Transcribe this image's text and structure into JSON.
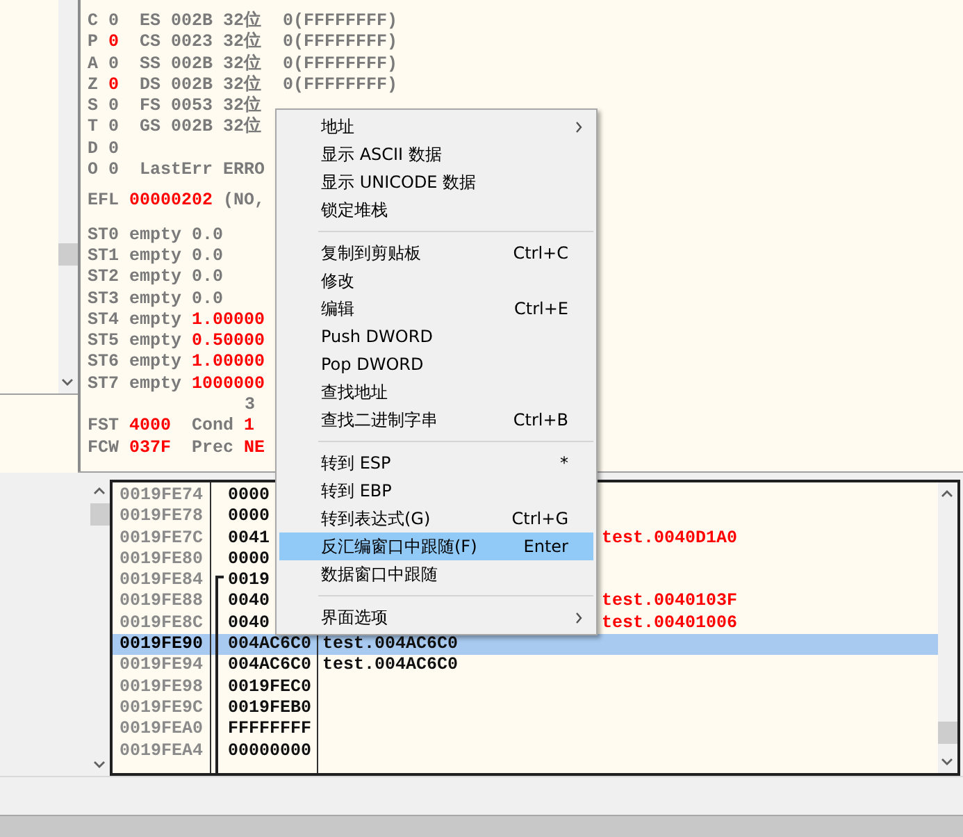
{
  "registers": {
    "groups": [
      [
        {
          "kind": "row",
          "segments": [
            {
              "text": "C",
              "changed": false
            },
            {
              "text": "0",
              "changed": false
            },
            {
              "text": " ES 002B 32位  0(FFFFFFFF)",
              "changed": false
            }
          ]
        },
        {
          "kind": "row",
          "segments": [
            {
              "text": "P",
              "changed": false
            },
            {
              "text": "0",
              "changed": true
            },
            {
              "text": " CS 0023 32位  0(FFFFFFFF)",
              "changed": false
            }
          ]
        },
        {
          "kind": "row",
          "segments": [
            {
              "text": "A",
              "changed": false
            },
            {
              "text": "0",
              "changed": false
            },
            {
              "text": " SS 002B 32位  0(FFFFFFFF)",
              "changed": false
            }
          ]
        },
        {
          "kind": "row",
          "segments": [
            {
              "text": "Z",
              "changed": false
            },
            {
              "text": "0",
              "changed": true
            },
            {
              "text": " DS 002B 32位  0(FFFFFFFF)",
              "changed": false
            }
          ]
        },
        {
          "kind": "row",
          "segments": [
            {
              "text": "S",
              "changed": false
            },
            {
              "text": "0",
              "changed": false
            },
            {
              "text": " FS 0053 32位",
              "changed": false
            }
          ]
        },
        {
          "kind": "row",
          "segments": [
            {
              "text": "T",
              "changed": false
            },
            {
              "text": "0",
              "changed": false
            },
            {
              "text": " GS 002B 32位",
              "changed": false
            }
          ]
        },
        {
          "kind": "row",
          "segments": [
            {
              "text": "D",
              "changed": false
            },
            {
              "text": "0",
              "changed": false
            }
          ]
        },
        {
          "kind": "row",
          "segments": [
            {
              "text": "O",
              "changed": false
            },
            {
              "text": "0",
              "changed": false
            },
            {
              "text": " LastErr ERRO",
              "changed": false
            }
          ]
        }
      ],
      [
        {
          "kind": "row",
          "segments": [
            {
              "text": "EFL",
              "changed": false
            },
            {
              "text": "00000202",
              "changed": true
            },
            {
              "text": "(NO,",
              "changed": false
            }
          ]
        }
      ],
      [
        {
          "kind": "row",
          "segments": [
            {
              "text": "ST0",
              "changed": false
            },
            {
              "text": "empty",
              "changed": false
            },
            {
              "text": "0.0",
              "changed": false
            }
          ]
        },
        {
          "kind": "row",
          "segments": [
            {
              "text": "ST1",
              "changed": false
            },
            {
              "text": "empty",
              "changed": false
            },
            {
              "text": "0.0",
              "changed": false
            }
          ]
        },
        {
          "kind": "row",
          "segments": [
            {
              "text": "ST2",
              "changed": false
            },
            {
              "text": "empty",
              "changed": false
            },
            {
              "text": "0.0",
              "changed": false
            }
          ]
        },
        {
          "kind": "row",
          "segments": [
            {
              "text": "ST3",
              "changed": false
            },
            {
              "text": "empty",
              "changed": false
            },
            {
              "text": "0.0",
              "changed": false
            }
          ]
        },
        {
          "kind": "row",
          "segments": [
            {
              "text": "ST4",
              "changed": false
            },
            {
              "text": "empty",
              "changed": false
            },
            {
              "text": "1.00000",
              "changed": true
            }
          ]
        },
        {
          "kind": "row",
          "segments": [
            {
              "text": "ST5",
              "changed": false
            },
            {
              "text": "empty",
              "changed": false
            },
            {
              "text": "0.50000",
              "changed": true
            }
          ]
        },
        {
          "kind": "row",
          "segments": [
            {
              "text": "ST6",
              "changed": false
            },
            {
              "text": "empty",
              "changed": false
            },
            {
              "text": "1.00000",
              "changed": true
            }
          ]
        },
        {
          "kind": "row",
          "segments": [
            {
              "text": "ST7",
              "changed": false
            },
            {
              "text": "empty",
              "changed": false
            },
            {
              "text": "1000000",
              "changed": true
            }
          ]
        },
        {
          "kind": "header",
          "segments": [
            {
              "text": "3",
              "changed": false
            }
          ]
        },
        {
          "kind": "row",
          "segments": [
            {
              "text": "FST",
              "changed": false
            },
            {
              "text": "4000",
              "changed": true
            },
            {
              "text": " Cond",
              "changed": false
            },
            {
              "text": "1",
              "changed": true
            }
          ]
        },
        {
          "kind": "row",
          "segments": [
            {
              "text": "FCW",
              "changed": false
            },
            {
              "text": "037F",
              "changed": true
            },
            {
              "text": " Prec",
              "changed": false
            },
            {
              "text": "NE",
              "changed": true
            }
          ]
        }
      ]
    ]
  },
  "stack": {
    "rows": [
      {
        "address": "0019FE74",
        "value": "0000",
        "selected": false
      },
      {
        "address": "0019FE78",
        "value": "0000",
        "selected": false
      },
      {
        "address": "0019FE7C",
        "value": "0041",
        "comment": "test.0040D1A0",
        "comment_highlighted": true,
        "selected": false
      },
      {
        "address": "0019FE80",
        "value": "0000",
        "selected": false
      },
      {
        "address": "0019FE84",
        "value": "0019",
        "selected": false
      },
      {
        "address": "0019FE88",
        "value": "0040",
        "comment": "test.0040103F",
        "comment_highlighted": true,
        "selected": false
      },
      {
        "address": "0019FE8C",
        "value": "0040",
        "comment": "test.00401006",
        "comment_highlighted": true,
        "selected": false
      },
      {
        "address": "0019FE90",
        "value": "004AC6C0",
        "comment": "test.004AC6C0",
        "comment_highlighted": false,
        "selected": true
      },
      {
        "address": "0019FE94",
        "value": "004AC6C0",
        "comment": "test.004AC6C0",
        "comment_highlighted": false,
        "selected": false
      },
      {
        "address": "0019FE98",
        "value": "0019FEC0",
        "selected": false
      },
      {
        "address": "0019FE9C",
        "value": "0019FEB0",
        "selected": false
      },
      {
        "address": "0019FEA0",
        "value": "FFFFFFFF",
        "selected": false
      },
      {
        "address": "0019FEA4",
        "value": "00000000",
        "selected": false
      }
    ]
  },
  "context_menu": {
    "items": [
      {
        "kind": "item",
        "label": "地址",
        "submenu": true,
        "selected": false
      },
      {
        "kind": "item",
        "label": "显示 ASCII 数据",
        "submenu": false,
        "selected": false
      },
      {
        "kind": "item",
        "label": "显示 UNICODE 数据",
        "submenu": false,
        "selected": false
      },
      {
        "kind": "item",
        "label": "锁定堆栈",
        "submenu": false,
        "selected": false
      },
      {
        "kind": "separator"
      },
      {
        "kind": "item",
        "label": "复制到剪贴板",
        "shortcut": "Ctrl+C",
        "submenu": false,
        "selected": false
      },
      {
        "kind": "item",
        "label": "修改",
        "submenu": false,
        "selected": false
      },
      {
        "kind": "item",
        "label": "编辑",
        "shortcut": "Ctrl+E",
        "submenu": false,
        "selected": false
      },
      {
        "kind": "item",
        "label": "Push DWORD",
        "submenu": false,
        "selected": false
      },
      {
        "kind": "item",
        "label": "Pop DWORD",
        "submenu": false,
        "selected": false
      },
      {
        "kind": "item",
        "label": "查找地址",
        "submenu": false,
        "selected": false
      },
      {
        "kind": "item",
        "label": "查找二进制字串",
        "shortcut": "Ctrl+B",
        "submenu": false,
        "selected": false
      },
      {
        "kind": "separator"
      },
      {
        "kind": "item",
        "label": "转到 ESP",
        "shortcut": "*",
        "submenu": false,
        "selected": false
      },
      {
        "kind": "item",
        "label": "转到 EBP",
        "submenu": false,
        "selected": false
      },
      {
        "kind": "item",
        "label": "转到表达式(G)",
        "shortcut": "Ctrl+G",
        "submenu": false,
        "selected": false
      },
      {
        "kind": "item",
        "label": "反汇编窗口中跟随(F)",
        "shortcut": "Enter",
        "submenu": false,
        "selected": true
      },
      {
        "kind": "item",
        "label": "数据窗口中跟随",
        "submenu": false,
        "selected": false
      },
      {
        "kind": "separator"
      },
      {
        "kind": "item",
        "label": "界面选项",
        "submenu": true,
        "selected": false
      }
    ]
  }
}
